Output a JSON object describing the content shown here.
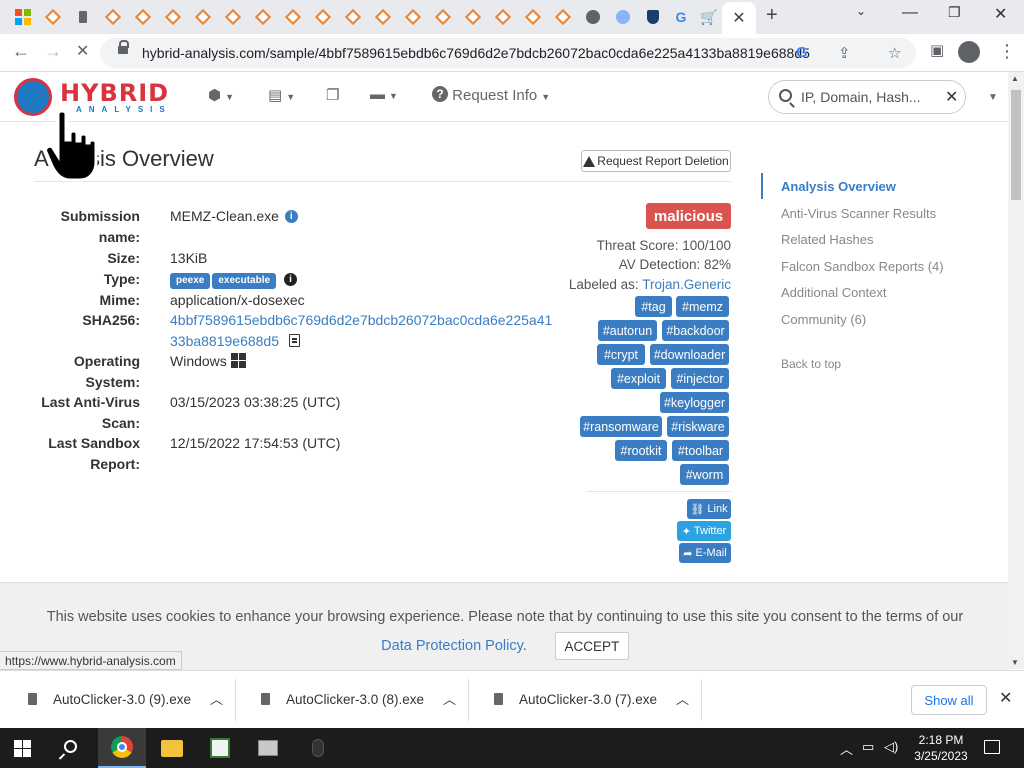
{
  "browser": {
    "url": "hybrid-analysis.com/sample/4bbf7589615ebdb6c769d6d2e7bdcb26072bac0cda6e225a4133ba8819e688d5",
    "tab_close": "✕",
    "new_tab": "+"
  },
  "site": {
    "logo_top": "HYBRID",
    "logo_bottom": "ANALYSIS",
    "nav_request_info": "Request Info",
    "search_placeholder": "IP, Domain, Hash..."
  },
  "overview": {
    "title": "Analysis Overview",
    "request_deletion": "Request Report Deletion",
    "fields": {
      "submission_name_label": "Submission",
      "submission_name_label2": "name:",
      "submission_name": "MEMZ-Clean.exe",
      "size_label": "Size:",
      "size": "13KiB",
      "type_label": "Type:",
      "type_badges": [
        "peexe",
        "executable"
      ],
      "mime_label": "Mime:",
      "mime": "application/x-dosexec",
      "sha256_label": "SHA256:",
      "sha256_line1": "4bbf7589615ebdb6c769d6d2e7bdcb26072bac0cda6e225a41",
      "sha256_line2": "33ba8819e688d5",
      "os_label1": "Operating",
      "os_label2": "System:",
      "os": "Windows",
      "last_av_label1": "Last Anti-Virus",
      "last_av_label2": "Scan:",
      "last_av": "03/15/2023 03:38:25 (UTC)",
      "last_sandbox_label1": "Last Sandbox",
      "last_sandbox_label2": "Report:",
      "last_sandbox": "12/15/2022 17:54:53 (UTC)"
    },
    "verdict": "malicious",
    "threat_score": "Threat Score: 100/100",
    "av_detection": "AV Detection: 82%",
    "labeled_as_prefix": "Labeled as:",
    "labeled_as": "Trojan.Generic",
    "tags": [
      "#tag",
      "#memz",
      "#autorun",
      "#backdoor",
      "#crypt",
      "#downloader",
      "#exploit",
      "#injector",
      "#keylogger",
      "#ransomware",
      "#riskware",
      "#rootkit",
      "#toolbar",
      "#worm"
    ],
    "share": {
      "link": "Link",
      "twitter": "Twitter",
      "email": "E-Mail"
    }
  },
  "sidenav": {
    "items": [
      "Analysis Overview",
      "Anti-Virus Scanner Results",
      "Related Hashes",
      "Falcon Sandbox Reports (4)",
      "Additional Context",
      "Community (6)"
    ],
    "back_to_top": "Back to top"
  },
  "cookie": {
    "text": "This website uses cookies to enhance your browsing experience. Please note that by continuing to use this site you consent to the terms of our",
    "link1": "Data",
    "link2": "Protection Policy",
    "after_link": ".",
    "accept": "ACCEPT"
  },
  "status_url": "https://www.hybrid-analysis.com",
  "downloads": {
    "items": [
      "AutoClicker-3.0 (9).exe",
      "AutoClicker-3.0 (8).exe",
      "AutoClicker-3.0 (7).exe"
    ],
    "show_all": "Show all"
  },
  "taskbar": {
    "time": "2:18 PM",
    "date": "3/25/2023"
  },
  "colors": {
    "accent": "#3a7dc2",
    "malicious": "#d9534f",
    "logo_red": "#d9333f"
  }
}
